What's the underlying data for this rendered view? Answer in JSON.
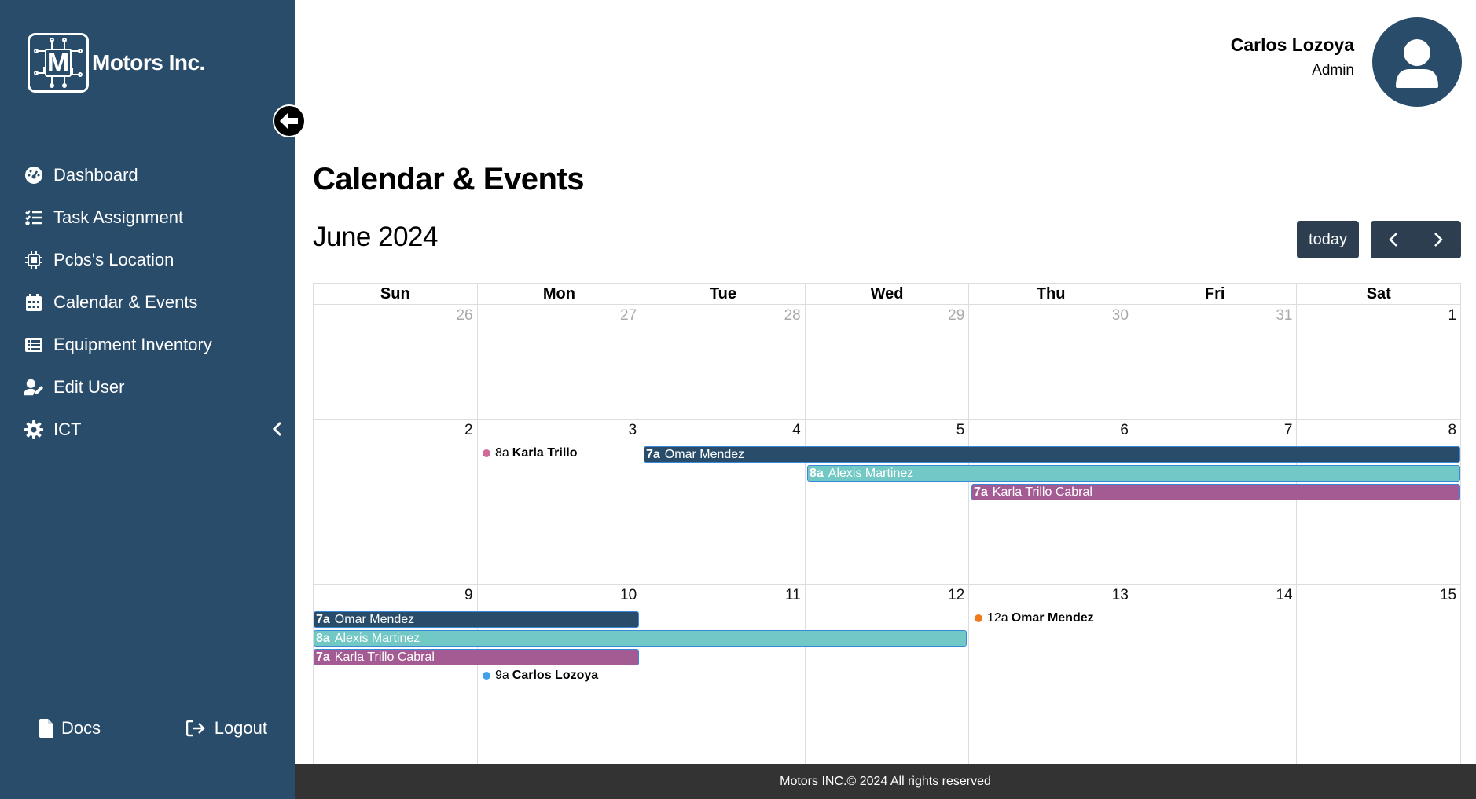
{
  "brand": {
    "name": "Motors Inc.",
    "logo_letter": "M"
  },
  "sidebar": {
    "items": [
      {
        "label": "Dashboard",
        "icon": "gauge-icon"
      },
      {
        "label": "Task Assignment",
        "icon": "list-check-icon"
      },
      {
        "label": "Pcbs's Location",
        "icon": "chip-icon"
      },
      {
        "label": "Calendar & Events",
        "icon": "calendar-icon"
      },
      {
        "label": "Equipment Inventory",
        "icon": "table-list-icon"
      },
      {
        "label": "Edit User",
        "icon": "user-pen-icon"
      },
      {
        "label": "ICT",
        "icon": "gear-icon"
      }
    ],
    "bottom": {
      "docs": "Docs",
      "logout": "Logout"
    }
  },
  "user": {
    "name": "Carlos Lozoya",
    "role": "Admin"
  },
  "page": {
    "title": "Calendar & Events",
    "month": "June 2024",
    "today_label": "today"
  },
  "calendar": {
    "weekdays": [
      "Sun",
      "Mon",
      "Tue",
      "Wed",
      "Thu",
      "Fri",
      "Sat"
    ],
    "weeks": [
      [
        "26",
        "27",
        "28",
        "29",
        "30",
        "31",
        "1"
      ],
      [
        "2",
        "3",
        "4",
        "5",
        "6",
        "7",
        "8"
      ],
      [
        "9",
        "10",
        "11",
        "12",
        "13",
        "14",
        "15"
      ]
    ],
    "events": {
      "w2_karla_dot": {
        "time": "8a",
        "title": "Karla Trillo",
        "color": "#d06a9a"
      },
      "w2_omar": {
        "time": "7a",
        "title": "Omar Mendez",
        "color": "#284c69"
      },
      "w2_alexis": {
        "time": "8a",
        "title": "Alexis Martinez",
        "color": "#72c8c4"
      },
      "w2_karla_bar": {
        "time": "7a",
        "title": "Karla Trillo Cabral",
        "color": "#a45a92"
      },
      "w3_omar": {
        "time": "7a",
        "title": "Omar Mendez",
        "color": "#284c69"
      },
      "w3_alexis": {
        "time": "8a",
        "title": "Alexis Martinez",
        "color": "#72c8c4"
      },
      "w3_karla_bar": {
        "time": "7a",
        "title": "Karla Trillo Cabral",
        "color": "#a45a92"
      },
      "w3_carlos_dot": {
        "time": "9a",
        "title": "Carlos Lozoya",
        "color": "#3fa0e8"
      },
      "w3_omar_dot": {
        "time": "12a",
        "title": "Omar Mendez",
        "color": "#f07a1a"
      }
    }
  },
  "footer": {
    "text": "Motors INC.© 2024 All rights reserved"
  }
}
